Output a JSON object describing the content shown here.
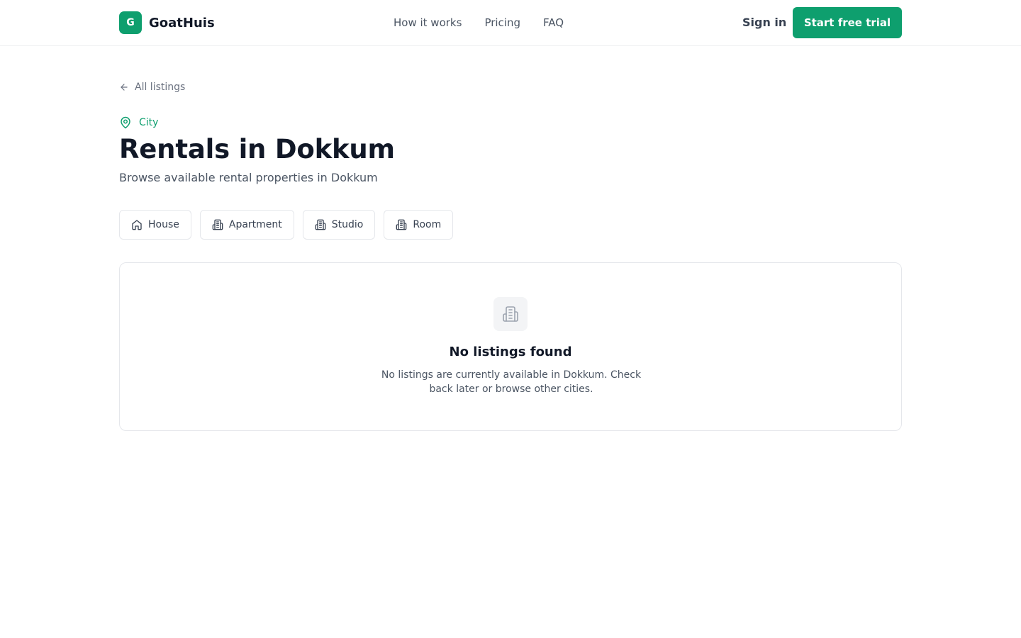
{
  "header": {
    "logo_letter": "G",
    "brand": "GoatHuis",
    "nav": [
      {
        "label": "How it works"
      },
      {
        "label": "Pricing"
      },
      {
        "label": "FAQ"
      }
    ],
    "signin_label": "Sign in",
    "cta_label": "Start free trial"
  },
  "back_link": {
    "label": "All listings",
    "icon": "arrow-left-icon"
  },
  "eyebrow": {
    "label": "City",
    "icon": "map-pin-icon"
  },
  "page": {
    "title": "Rentals in Dokkum",
    "subtitle": "Browse available rental properties in Dokkum"
  },
  "filters": [
    {
      "label": "House",
      "icon": "home-icon"
    },
    {
      "label": "Apartment",
      "icon": "building-icon"
    },
    {
      "label": "Studio",
      "icon": "building-icon"
    },
    {
      "label": "Room",
      "icon": "building-icon"
    }
  ],
  "empty_state": {
    "icon": "building-icon",
    "title": "No listings found",
    "message": "No listings are currently available in Dokkum. Check back later or browse other cities."
  },
  "colors": {
    "accent": "#0e9f6e",
    "text": "#111827",
    "muted": "#4b5563",
    "border": "#e5e7eb"
  }
}
